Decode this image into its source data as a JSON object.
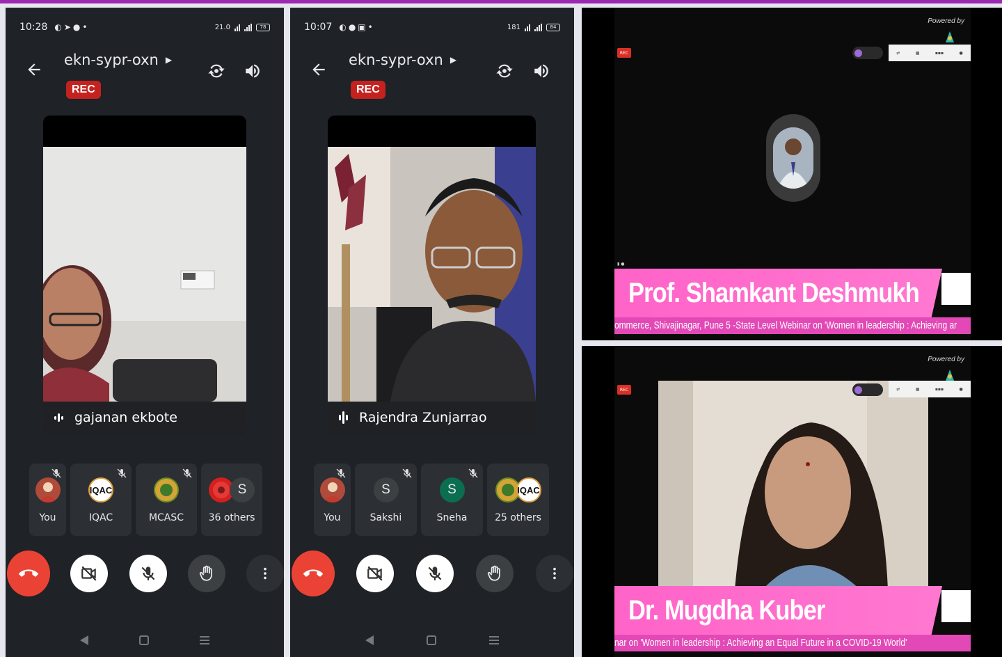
{
  "phone_left": {
    "status": {
      "time": "10:28",
      "net_speed": "21.0",
      "battery": "78"
    },
    "meeting_code": "ekn-sypr-oxn",
    "rec_label": "REC",
    "speaker_name": "gajanan ekbote",
    "participants": [
      {
        "label": "You",
        "avatar": "photo"
      },
      {
        "label": "IQAC",
        "avatar": "IQAC"
      },
      {
        "label": "MCASC",
        "avatar": "emblem"
      },
      {
        "label": "36 others",
        "avatar": "stack",
        "letter": "S"
      }
    ]
  },
  "phone_right": {
    "status": {
      "time": "10:07",
      "net_speed": "181",
      "battery": "84"
    },
    "meeting_code": "ekn-sypr-oxn",
    "rec_label": "REC",
    "speaker_name": "Rajendra Zunjarrao",
    "participants": [
      {
        "label": "You",
        "avatar": "photo"
      },
      {
        "label": "Sakshi",
        "avatar": "S"
      },
      {
        "label": "Sneha",
        "avatar": "S"
      },
      {
        "label": "25 others",
        "avatar": "stack",
        "letter": "IQAC"
      }
    ]
  },
  "webinar_top": {
    "powered_by": "Powered by",
    "rec": "REC",
    "speaker_name": "Prof. Shamkant Deshmukh",
    "ticker": "ommerce, Shivajinagar, Pune 5 -State Level Webinar on 'Women in leadership : Achieving ar"
  },
  "webinar_bottom": {
    "powered_by": "Powered by",
    "rec": "REC",
    "speaker_name": "Dr. Mugdha Kuber",
    "ticker": "nar on 'Women in leadership : Achieving an Equal Future in a COVID-19 World'"
  },
  "colors": {
    "end_call": "#ea4335",
    "rec_badge": "#c5221f",
    "lower_third_pink": "#ff63c8",
    "top_strip": "#9c27b0"
  }
}
